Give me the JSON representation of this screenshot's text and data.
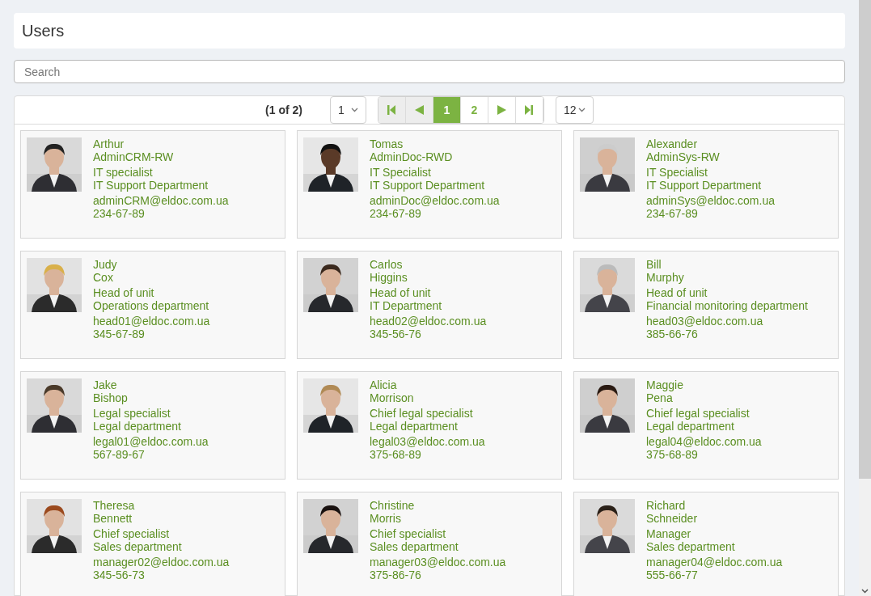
{
  "header": {
    "title": "Users"
  },
  "search": {
    "placeholder": "Search"
  },
  "paginator": {
    "summary": "(1 of 2)",
    "page_select": "1",
    "nav": [
      {
        "kind": "first",
        "disabled": true
      },
      {
        "kind": "prev",
        "disabled": true
      }
    ],
    "pages": [
      {
        "label": "1",
        "selected": true
      },
      {
        "label": "2",
        "selected": false
      }
    ],
    "nav_after": [
      {
        "kind": "next",
        "disabled": false
      },
      {
        "kind": "last",
        "disabled": false
      }
    ],
    "rows_per_page": "12"
  },
  "users": [
    {
      "first_name": "Arthur",
      "last_name": "AdminCRM-RW",
      "position": "IT specialist",
      "department": "IT Support Department",
      "email": "adminCRM@eldoc.com.ua",
      "phone": "234-67-89"
    },
    {
      "first_name": "Tomas",
      "last_name": "AdminDoc-RWD",
      "position": "IT Specialist",
      "department": "IT Support Department",
      "email": "adminDoc@eldoc.com.ua",
      "phone": "234-67-89"
    },
    {
      "first_name": "Alexander",
      "last_name": "AdminSys-RW",
      "position": "IT Specialist",
      "department": "IT Support Department",
      "email": "adminSys@eldoc.com.ua",
      "phone": "234-67-89"
    },
    {
      "first_name": "Judy",
      "last_name": "Cox",
      "position": "Head of unit",
      "department": "Operations department",
      "email": "head01@eldoc.com.ua",
      "phone": "345-67-89"
    },
    {
      "first_name": "Carlos",
      "last_name": "Higgins",
      "position": "Head of unit",
      "department": "IT Department",
      "email": "head02@eldoc.com.ua",
      "phone": "345-56-76"
    },
    {
      "first_name": "Bill",
      "last_name": "Murphy",
      "position": "Head of unit",
      "department": "Financial monitoring department",
      "email": "head03@eldoc.com.ua",
      "phone": "385-66-76"
    },
    {
      "first_name": "Jake",
      "last_name": "Bishop",
      "position": "Legal specialist",
      "department": "Legal department",
      "email": "legal01@eldoc.com.ua",
      "phone": "567-89-67"
    },
    {
      "first_name": "Alicia",
      "last_name": "Morrison",
      "position": "Chief legal specialist",
      "department": "Legal department",
      "email": "legal03@eldoc.com.ua",
      "phone": "375-68-89"
    },
    {
      "first_name": "Maggie",
      "last_name": "Pena",
      "position": "Chief legal specialist",
      "department": "Legal department",
      "email": "legal04@eldoc.com.ua",
      "phone": "375-68-89"
    },
    {
      "first_name": "Theresa",
      "last_name": "Bennett",
      "position": "Chief specialist",
      "department": "Sales department",
      "email": "manager02@eldoc.com.ua",
      "phone": "345-56-73"
    },
    {
      "first_name": "Christine",
      "last_name": "Morris",
      "position": "Chief specialist",
      "department": "Sales department",
      "email": "manager03@eldoc.com.ua",
      "phone": "375-86-76"
    },
    {
      "first_name": "Richard",
      "last_name": "Schneider",
      "position": "Manager",
      "department": "Sales department",
      "email": "manager04@eldoc.com.ua",
      "phone": "555-66-77"
    }
  ]
}
